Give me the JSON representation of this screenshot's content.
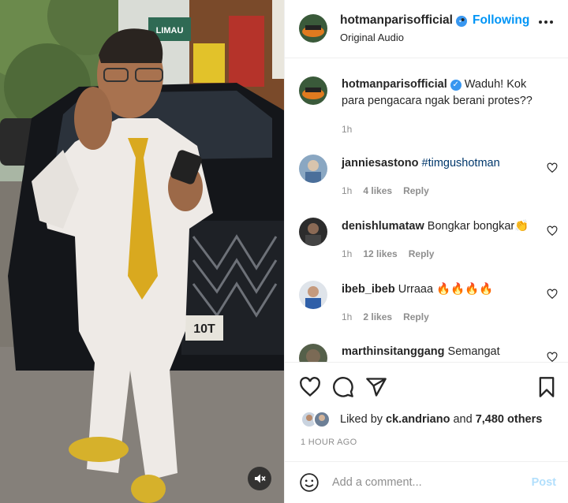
{
  "header": {
    "username": "hotmanparisofficial",
    "follow_label": "Following",
    "separator": "•",
    "subtitle": "Original Audio"
  },
  "caption": {
    "username": "hotmanparisofficial",
    "text": "Waduh! Kok para pengacara ngak berani protes??",
    "time": "1h"
  },
  "comments": [
    {
      "username": "janniesastono",
      "text": "#timgushotman",
      "time": "1h",
      "likes": "4 likes",
      "reply": "Reply"
    },
    {
      "username": "denishlumataw",
      "text": "Bongkar bongkar",
      "emoji": "👏",
      "time": "1h",
      "likes": "12 likes",
      "reply": "Reply"
    },
    {
      "username": "ibeb_ibeb",
      "text": "Urraaa",
      "emoji": "🔥🔥🔥🔥",
      "time": "1h",
      "likes": "2 likes",
      "reply": "Reply"
    },
    {
      "username": "marthinsitanggang",
      "text": "Semangat"
    }
  ],
  "likes": {
    "prefix": "Liked by",
    "user": "ck.andriano",
    "and": "and",
    "count": "7,480 others"
  },
  "post_time": "1 HOUR AGO",
  "comment_box": {
    "placeholder": "Add a comment...",
    "post_label": "Post"
  },
  "video": {
    "shop_sign": "LIMAU",
    "plate_text": "10T"
  },
  "icons": {
    "more": "more-options-icon",
    "heart": "heart-icon",
    "comment": "comment-icon",
    "share": "share-icon",
    "save": "bookmark-icon",
    "emoji": "emoji-icon",
    "mute": "mute-icon"
  },
  "colors": {
    "accent": "#0095f6",
    "verified": "#3897f0",
    "muted_text": "#8e8e8e",
    "post_disabled": "#b2dffc"
  }
}
